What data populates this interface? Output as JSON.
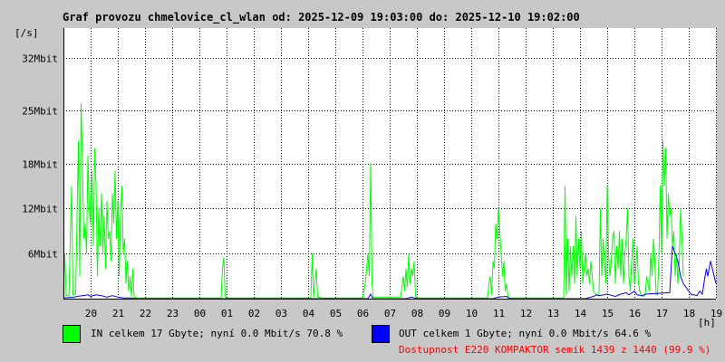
{
  "window": {
    "title": "Graf provozu chmelovice_cl_wlan od: 2025-12-09 19:03:00 do: 2025-12-10 19:02:00"
  },
  "chart_data": {
    "type": "line",
    "ylabel": "[/s]",
    "xlabel": "[h]",
    "y_ticks": [
      {
        "value": 6,
        "label": "6Mbit"
      },
      {
        "value": 12,
        "label": "12Mbit"
      },
      {
        "value": 18,
        "label": "18Mbit"
      },
      {
        "value": 25,
        "label": "25Mbit"
      },
      {
        "value": 32,
        "label": "32Mbit"
      }
    ],
    "ylim": [
      0,
      36
    ],
    "x_ticks": [
      "20",
      "21",
      "22",
      "23",
      "00",
      "01",
      "02",
      "03",
      "04",
      "05",
      "06",
      "07",
      "08",
      "09",
      "10",
      "11",
      "12",
      "13",
      "14",
      "15",
      "16",
      "17",
      "18",
      "19"
    ],
    "x_range_hours": [
      0,
      24
    ],
    "grid": true,
    "series": [
      {
        "name": "IN",
        "color": "#00ff00",
        "points": [
          [
            0.0,
            0.4
          ],
          [
            0.05,
            6.0
          ],
          [
            0.1,
            0.4
          ],
          [
            0.2,
            0.4
          ],
          [
            0.3,
            15.0
          ],
          [
            0.35,
            0.5
          ],
          [
            0.45,
            0.6
          ],
          [
            0.55,
            21.0
          ],
          [
            0.6,
            3.0
          ],
          [
            0.65,
            26.0
          ],
          [
            0.7,
            18.0
          ],
          [
            0.75,
            8.0
          ],
          [
            0.8,
            10.0
          ],
          [
            0.85,
            6.0
          ],
          [
            0.9,
            19.0
          ],
          [
            0.95,
            12.0
          ],
          [
            1.0,
            10.0
          ],
          [
            1.05,
            17.0
          ],
          [
            1.1,
            7.0
          ],
          [
            1.15,
            20.0
          ],
          [
            1.2,
            15.0
          ],
          [
            1.25,
            3.0
          ],
          [
            1.3,
            12.0
          ],
          [
            1.35,
            7.0
          ],
          [
            1.4,
            14.0
          ],
          [
            1.45,
            6.0
          ],
          [
            1.5,
            11.0
          ],
          [
            1.55,
            4.0
          ],
          [
            1.6,
            13.0
          ],
          [
            1.65,
            8.0
          ],
          [
            1.7,
            9.0
          ],
          [
            1.75,
            5.0
          ],
          [
            1.8,
            14.0
          ],
          [
            1.85,
            10.0
          ],
          [
            1.9,
            17.0
          ],
          [
            1.95,
            8.0
          ],
          [
            2.0,
            13.0
          ],
          [
            2.05,
            3.0
          ],
          [
            2.1,
            11.0
          ],
          [
            2.15,
            15.0
          ],
          [
            2.2,
            6.0
          ],
          [
            2.25,
            8.0
          ],
          [
            2.3,
            2.0
          ],
          [
            2.35,
            5.0
          ],
          [
            2.4,
            1.0
          ],
          [
            2.45,
            3.0
          ],
          [
            2.5,
            0.3
          ],
          [
            2.55,
            4.0
          ],
          [
            2.6,
            0.2
          ],
          [
            2.7,
            0.1
          ],
          [
            3.0,
            0.1
          ],
          [
            5.8,
            0.1
          ],
          [
            5.85,
            4.0
          ],
          [
            5.9,
            5.5
          ],
          [
            5.95,
            0.3
          ],
          [
            6.0,
            0.1
          ],
          [
            9.1,
            0.1
          ],
          [
            9.15,
            6.0
          ],
          [
            9.2,
            0.2
          ],
          [
            9.3,
            4.0
          ],
          [
            9.35,
            0.2
          ],
          [
            9.5,
            0.1
          ],
          [
            11.0,
            0.1
          ],
          [
            11.1,
            2.0
          ],
          [
            11.2,
            6.0
          ],
          [
            11.25,
            3.0
          ],
          [
            11.3,
            18.0
          ],
          [
            11.35,
            2.0
          ],
          [
            11.4,
            0.2
          ],
          [
            12.4,
            0.2
          ],
          [
            12.5,
            3.0
          ],
          [
            12.55,
            1.0
          ],
          [
            12.6,
            4.0
          ],
          [
            12.65,
            1.5
          ],
          [
            12.7,
            6.0
          ],
          [
            12.75,
            2.0
          ],
          [
            12.8,
            4.0
          ],
          [
            12.85,
            3.0
          ],
          [
            12.9,
            5.0
          ],
          [
            12.95,
            0.3
          ],
          [
            13.0,
            0.1
          ],
          [
            15.6,
            0.1
          ],
          [
            15.65,
            2.0
          ],
          [
            15.7,
            3.0
          ],
          [
            15.75,
            0.5
          ],
          [
            15.8,
            5.0
          ],
          [
            15.85,
            4.0
          ],
          [
            15.9,
            10.0
          ],
          [
            15.95,
            8.0
          ],
          [
            16.0,
            12.0
          ],
          [
            16.05,
            9.0
          ],
          [
            16.1,
            6.0
          ],
          [
            16.15,
            3.0
          ],
          [
            16.2,
            5.0
          ],
          [
            16.25,
            1.0
          ],
          [
            16.3,
            2.0
          ],
          [
            16.35,
            0.3
          ],
          [
            16.4,
            0.1
          ],
          [
            18.0,
            0.1
          ],
          [
            18.4,
            0.1
          ],
          [
            18.45,
            15.0
          ],
          [
            18.5,
            0.5
          ],
          [
            18.55,
            8.0
          ],
          [
            18.6,
            1.0
          ],
          [
            18.65,
            7.0
          ],
          [
            18.7,
            3.0
          ],
          [
            18.75,
            7.0
          ],
          [
            18.8,
            2.0
          ],
          [
            18.85,
            11.0
          ],
          [
            18.9,
            3.0
          ],
          [
            18.95,
            8.0
          ],
          [
            19.0,
            4.0
          ],
          [
            19.05,
            9.0
          ],
          [
            19.1,
            2.0
          ],
          [
            19.15,
            4.0
          ],
          [
            19.2,
            6.0
          ],
          [
            19.25,
            3.0
          ],
          [
            19.3,
            4.0
          ],
          [
            19.35,
            2.0
          ],
          [
            19.4,
            5.0
          ],
          [
            19.45,
            3.0
          ],
          [
            19.5,
            1.0
          ],
          [
            19.6,
            0.5
          ],
          [
            19.7,
            0.5
          ],
          [
            19.75,
            12.0
          ],
          [
            19.8,
            3.0
          ],
          [
            19.85,
            8.0
          ],
          [
            19.9,
            5.0
          ],
          [
            19.95,
            2.0
          ],
          [
            20.0,
            15.0
          ],
          [
            20.05,
            6.0
          ],
          [
            20.1,
            3.0
          ],
          [
            20.15,
            5.0
          ],
          [
            20.2,
            8.0
          ],
          [
            20.25,
            9.0
          ],
          [
            20.3,
            2.0
          ],
          [
            20.35,
            7.0
          ],
          [
            20.4,
            4.0
          ],
          [
            20.45,
            9.0
          ],
          [
            20.5,
            3.0
          ],
          [
            20.55,
            8.0
          ],
          [
            20.6,
            2.0
          ],
          [
            20.65,
            6.0
          ],
          [
            20.7,
            8.0
          ],
          [
            20.75,
            12.0
          ],
          [
            20.8,
            3.0
          ],
          [
            20.85,
            1.0
          ],
          [
            20.9,
            5.0
          ],
          [
            20.95,
            8.0
          ],
          [
            21.0,
            2.0
          ],
          [
            21.05,
            4.0
          ],
          [
            21.1,
            7.0
          ],
          [
            21.15,
            2.0
          ],
          [
            21.2,
            1.0
          ],
          [
            21.25,
            0.5
          ],
          [
            21.3,
            0.3
          ],
          [
            21.4,
            0.5
          ],
          [
            21.45,
            3.0
          ],
          [
            21.5,
            2.0
          ],
          [
            21.55,
            1.0
          ],
          [
            21.6,
            6.0
          ],
          [
            21.65,
            3.0
          ],
          [
            21.7,
            8.0
          ],
          [
            21.75,
            5.0
          ],
          [
            21.8,
            0.5
          ],
          [
            21.85,
            0.5
          ],
          [
            21.9,
            5.0
          ],
          [
            21.95,
            15.0
          ],
          [
            22.0,
            6.0
          ],
          [
            22.05,
            21.0
          ],
          [
            22.1,
            15.0
          ],
          [
            22.15,
            20.0
          ],
          [
            22.2,
            8.0
          ],
          [
            22.25,
            14.0
          ],
          [
            22.3,
            11.0
          ],
          [
            22.35,
            12.0
          ],
          [
            22.4,
            7.0
          ],
          [
            22.45,
            9.0
          ],
          [
            22.5,
            3.0
          ],
          [
            22.55,
            6.0
          ],
          [
            22.6,
            2.0
          ],
          [
            22.65,
            5.0
          ],
          [
            22.7,
            12.0
          ],
          [
            22.75,
            8.0
          ],
          [
            22.8,
            3.0
          ]
        ]
      },
      {
        "name": "OUT",
        "color": "#0000ff",
        "points": [
          [
            0.0,
            0.1
          ],
          [
            0.4,
            0.2
          ],
          [
            0.5,
            0.3
          ],
          [
            0.7,
            0.4
          ],
          [
            0.9,
            0.5
          ],
          [
            1.0,
            0.3
          ],
          [
            1.2,
            0.5
          ],
          [
            1.4,
            0.4
          ],
          [
            1.6,
            0.2
          ],
          [
            1.8,
            0.4
          ],
          [
            2.0,
            0.2
          ],
          [
            2.2,
            0.1
          ],
          [
            2.5,
            0.1
          ],
          [
            2.7,
            0.0
          ],
          [
            11.2,
            0.0
          ],
          [
            11.3,
            0.6
          ],
          [
            11.35,
            0.2
          ],
          [
            11.4,
            0.0
          ],
          [
            12.6,
            0.0
          ],
          [
            12.8,
            0.2
          ],
          [
            13.0,
            0.0
          ],
          [
            15.8,
            0.0
          ],
          [
            16.0,
            0.2
          ],
          [
            16.3,
            0.3
          ],
          [
            16.4,
            0.0
          ],
          [
            19.2,
            0.0
          ],
          [
            19.5,
            0.3
          ],
          [
            19.6,
            0.5
          ],
          [
            19.7,
            0.4
          ],
          [
            20.0,
            0.6
          ],
          [
            20.2,
            0.4
          ],
          [
            20.3,
            0.3
          ],
          [
            20.5,
            0.6
          ],
          [
            20.7,
            0.8
          ],
          [
            20.8,
            0.5
          ],
          [
            21.0,
            1.0
          ],
          [
            21.1,
            0.5
          ],
          [
            21.3,
            0.4
          ],
          [
            21.4,
            0.6
          ],
          [
            22.3,
            0.8
          ],
          [
            22.4,
            7.0
          ],
          [
            22.5,
            6.0
          ],
          [
            22.6,
            5.0
          ],
          [
            22.7,
            3.0
          ],
          [
            22.8,
            2.0
          ],
          [
            22.9,
            1.5
          ],
          [
            23.0,
            1.0
          ],
          [
            23.1,
            0.5
          ],
          [
            23.2,
            0.5
          ],
          [
            23.3,
            0.4
          ],
          [
            23.4,
            1.0
          ],
          [
            23.5,
            0.6
          ],
          [
            23.6,
            3.0
          ],
          [
            23.65,
            4.0
          ],
          [
            23.7,
            3.0
          ],
          [
            23.8,
            5.0
          ],
          [
            23.9,
            3.5
          ],
          [
            24.0,
            2.0
          ]
        ]
      }
    ]
  },
  "legend": {
    "in": {
      "color": "#00ff00",
      "text": "IN celkem 17 Gbyte; nyní   0.0 Mbit/s 70.8 %"
    },
    "out": {
      "color": "#0000ff",
      "text": "OUT celkem 1 Gbyte; nyní   0.0 Mbit/s 64.6 %"
    }
  },
  "availability": {
    "text": "Dostupnost E220 KOMPAKTOR semik 1439 z 1440 (99.9 %)",
    "color": "#ff0000"
  }
}
